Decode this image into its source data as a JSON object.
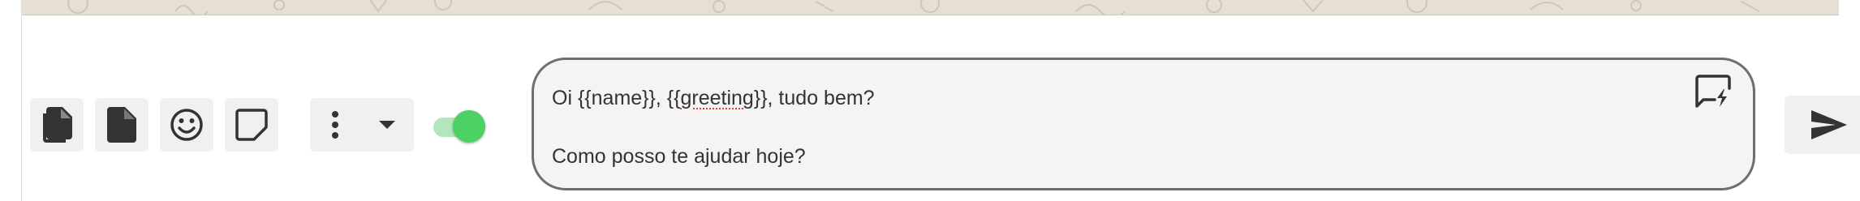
{
  "toolbar": {
    "attach_multiple_icon": "file-copy-icon",
    "attach_file_icon": "file-icon",
    "emoji_icon": "smiley-icon",
    "sticker_icon": "sticky-note-icon",
    "more_icon": "more-vertical-icon",
    "dropdown_icon": "caret-down-icon",
    "signature_toggle": {
      "on": true,
      "track_color": "#b4e6be",
      "knob_color": "#4cd264"
    }
  },
  "message": {
    "line1_prefix": "Oi {{name}}, {{",
    "line1_misspelled": "greeting",
    "line1_suffix": "}}, tudo bem?",
    "line2": "Como posso te ajudar hoje?",
    "quick_reply_icon": "quick-reply-icon"
  },
  "send": {
    "icon": "send-icon"
  },
  "colors": {
    "button_bg": "#f0f0f0",
    "icon": "#333333",
    "input_border": "#6e6e6e",
    "input_bg": "#f4f4f4",
    "wallpaper": "#e6dfd5"
  }
}
